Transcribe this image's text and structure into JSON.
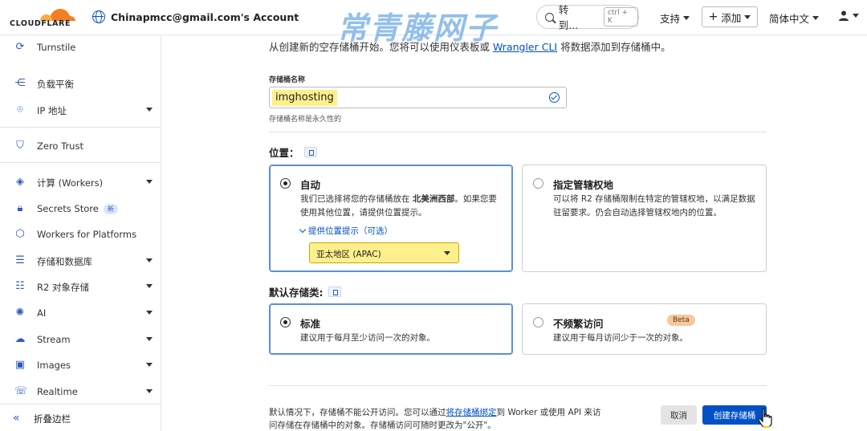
{
  "header": {
    "logo_text": "CLOUDFLARE",
    "account_label": "Chinapmcc@gmail.com's Account",
    "watermark": "常青藤网子",
    "goto_label": "转到...",
    "goto_shortcut": "ctrl + K",
    "support_label": "支持",
    "add_label": "添加",
    "language_label": "简体中文"
  },
  "sidebar": {
    "items": [
      {
        "label": "Turnstile",
        "icon": "turnstile-icon"
      },
      {
        "label": "负载平衡",
        "icon": "load-balancing-icon"
      },
      {
        "label": "IP 地址",
        "icon": "location-pin-icon"
      },
      {
        "label": "Zero Trust",
        "icon": "shield-icon"
      },
      {
        "label": "计算 (Workers)",
        "icon": "workers-icon"
      },
      {
        "label": "Secrets Store",
        "icon": "lock-icon",
        "badge": "新"
      },
      {
        "label": "Workers for Platforms",
        "icon": "cube-icon"
      },
      {
        "label": "存储和数据库",
        "icon": "database-icon"
      },
      {
        "label": "R2 对象存储",
        "icon": "r2-database-icon"
      },
      {
        "label": "AI",
        "icon": "ai-sparkle-icon"
      },
      {
        "label": "Stream",
        "icon": "stream-cloud-icon"
      },
      {
        "label": "Images",
        "icon": "image-icon"
      },
      {
        "label": "Realtime",
        "icon": "realtime-icon"
      }
    ],
    "collapse_label": "折叠边栏"
  },
  "main": {
    "intro_prefix": "从创建新的空存储桶开始。您将可以使用仪表板或",
    "intro_link": "Wrangler CLI",
    "intro_suffix": "将数据添加到存储桶中。",
    "bucket_name_label": "存储桶名称",
    "bucket_name_value": "imghosting",
    "bucket_name_helper": "存储桶名称是永久性的",
    "location_title": "位置：",
    "location_auto_title": "自动",
    "location_auto_desc_prefix": "我们已选择将您的存储桶放在",
    "location_auto_desc_bold": "北美洲西部",
    "location_auto_desc_suffix": "。如果您要使用其他位置，请提供位置提示。",
    "location_hint_link": "提供位置提示（可选）",
    "location_hint_value": "亚太地区 (APAC)",
    "location_jurisdiction_title": "指定管辖权地",
    "location_jurisdiction_desc": "可以将 R2 存储桶限制在特定的管辖权地，以满足数据驻留要求。仍会自动选择管辖权地内的位置。",
    "storage_class_title": "默认存储类:",
    "storage_standard_title": "标准",
    "storage_standard_desc": "建议用于每月至少访问一次的对象。",
    "storage_infrequent_title": "不频繁访问",
    "storage_infrequent_badge": "Beta",
    "storage_infrequent_desc": "建议用于每月访问少于一次的对象。",
    "footer_prefix": "默认情况下，存储桶不能公开访问。您可以通过",
    "footer_link": "将存储桶绑定",
    "footer_suffix": "到 Worker 或使用 API 来访问存储在存储桶中的对象。存储桶访问可随时更改为\"公开\"。",
    "cancel_label": "取消",
    "create_label": "创建存储桶"
  },
  "colors": {
    "accent": "#0051c3",
    "highlight": "#fdf08c",
    "beta_badge": "#f8c79b"
  }
}
